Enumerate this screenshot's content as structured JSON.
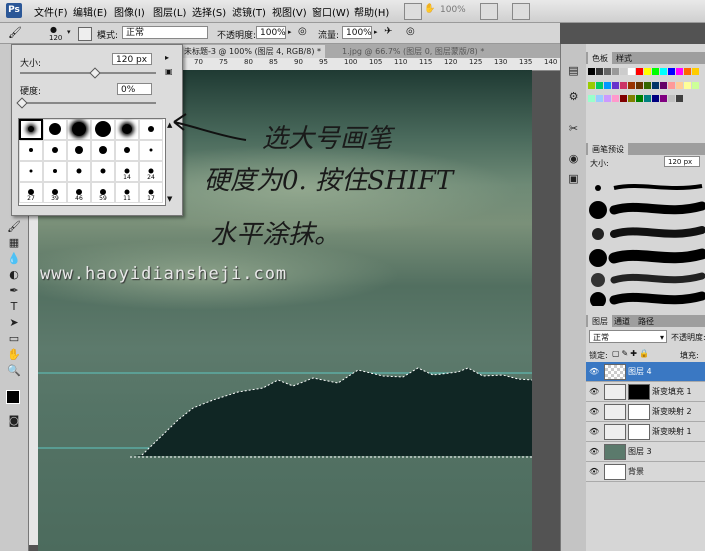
{
  "menu": {
    "logo": "Ps",
    "items": [
      "文件(F)",
      "编辑(E)",
      "图像(I)",
      "图层(L)",
      "选择(S)",
      "滤镜(T)",
      "视图(V)",
      "窗口(W)",
      "帮助(H)"
    ],
    "zoom": "100%"
  },
  "options": {
    "brush_size": "120",
    "mode_label": "模式:",
    "mode_value": "正常",
    "opacity_label": "不透明度:",
    "opacity_value": "100%",
    "flow_label": "流量:",
    "flow_value": "100%"
  },
  "doc_tabs": [
    {
      "label": "未标题-3 @ 100% (图层 4, RGB/8) *",
      "active": true
    },
    {
      "label": "1.jpg @ 66.7% (图层 0, 图层蒙版/8) *",
      "active": false
    }
  ],
  "ruler_ticks": [
    "70",
    "75",
    "80",
    "85",
    "90",
    "95",
    "100",
    "105",
    "110",
    "115",
    "120",
    "125",
    "130",
    "135",
    "140"
  ],
  "brush_panel": {
    "size_label": "大小:",
    "size_value": "120 px",
    "hardness_label": "硬度:",
    "hardness_value": "0%",
    "size_fraction": 0.55,
    "hardness_fraction": 0.0,
    "presets": [
      {
        "size": 6,
        "label": ""
      },
      {
        "size": 12,
        "label": ""
      },
      {
        "size": 14,
        "label": ""
      },
      {
        "size": 16,
        "label": ""
      },
      {
        "size": 10,
        "label": ""
      },
      {
        "size": 6,
        "label": ""
      },
      {
        "size": 4,
        "label": ""
      },
      {
        "size": 6,
        "label": ""
      },
      {
        "size": 8,
        "label": ""
      },
      {
        "size": 8,
        "label": ""
      },
      {
        "size": 6,
        "label": ""
      },
      {
        "size": 3,
        "label": ""
      },
      {
        "size": 3,
        "label": ""
      },
      {
        "size": 4,
        "label": ""
      },
      {
        "size": 5,
        "label": ""
      },
      {
        "size": 5,
        "label": ""
      },
      {
        "size": 5,
        "label": "14"
      },
      {
        "size": 5,
        "label": "24"
      },
      {
        "size": 6,
        "label": "27"
      },
      {
        "size": 6,
        "label": "39"
      },
      {
        "size": 6,
        "label": "46"
      },
      {
        "size": 6,
        "label": "59"
      },
      {
        "size": 5,
        "label": "11"
      },
      {
        "size": 5,
        "label": "17"
      }
    ]
  },
  "annotation": {
    "line1": "选大号画笔",
    "line2": "硬度为0. 按住SHIFT",
    "line3": "水平涂抹。"
  },
  "watermark": "www.haoyidiansheji.com",
  "swatches_panel": {
    "tabs": [
      "色板",
      "样式"
    ],
    "colors": [
      "#000000",
      "#333333",
      "#666666",
      "#999999",
      "#cccccc",
      "#ffffff",
      "#ff0000",
      "#ffff00",
      "#00ff00",
      "#00ffff",
      "#0000ff",
      "#ff00ff",
      "#ff6600",
      "#ffcc00",
      "#99cc00",
      "#00cc66",
      "#0099ff",
      "#6633cc",
      "#cc3366",
      "#993300",
      "#663300",
      "#336600",
      "#003366",
      "#660066",
      "#ff9999",
      "#ffcc99",
      "#ffff99",
      "#ccff99",
      "#99ffcc",
      "#99ccff",
      "#cc99ff",
      "#ff99cc",
      "#800000",
      "#808000",
      "#008000",
      "#008080",
      "#000080",
      "#800080",
      "#c0c0c0",
      "#404040"
    ]
  },
  "brush_presets_panel": {
    "tab": "画笔预设",
    "size_label": "大小:",
    "size_value": "120 px"
  },
  "layers_panel": {
    "tabs": [
      "图层",
      "通道",
      "路径"
    ],
    "blend_mode": "正常",
    "opacity_label": "不透明度:",
    "lock_label": "锁定:",
    "fill_label": "填充:",
    "layers": [
      {
        "name": "图层 4",
        "selected": true
      },
      {
        "name": "渐变填充 1",
        "selected": false
      },
      {
        "name": "渐变映射 2",
        "selected": false
      },
      {
        "name": "渐变映射 1",
        "selected": false
      },
      {
        "name": "图层 3",
        "selected": false
      },
      {
        "name": "背景",
        "selected": false
      }
    ]
  }
}
